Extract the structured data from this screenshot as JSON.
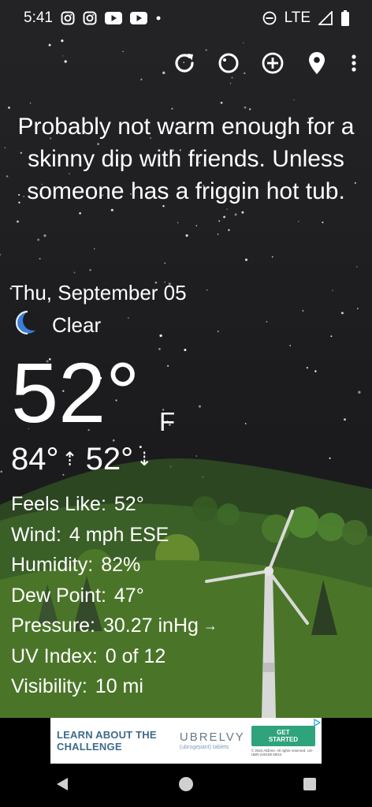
{
  "status": {
    "time": "5:41",
    "network": "LTE",
    "notification_icons": [
      "instagram-icon",
      "instagram-icon",
      "youtube-icon",
      "youtube-icon",
      "dot-icon"
    ],
    "right_icons": [
      "do-not-disturb-icon",
      "signal-icon",
      "battery-icon"
    ]
  },
  "toolbar": {
    "icons": [
      "refresh-icon",
      "theme-icon",
      "add-location-icon",
      "location-pin-icon",
      "overflow-menu-icon"
    ]
  },
  "weather": {
    "headline": "Probably not warm enough for a skinny dip with friends. Unless someone has a friggin hot tub.",
    "date": "Thu, September 05",
    "condition": "Clear",
    "condition_icon": "moon-icon",
    "temperature": "52°",
    "unit": "F",
    "high": "84°",
    "low": "52°",
    "details": [
      {
        "label": "Feels Like:",
        "value": "52°"
      },
      {
        "label": "Wind:",
        "value": "4 mph ESE"
      },
      {
        "label": "Humidity:",
        "value": "82%"
      },
      {
        "label": "Dew Point:",
        "value": "47°"
      },
      {
        "label": "Pressure:",
        "value": "30.27 inHg",
        "trend": "→"
      },
      {
        "label": "UV Index:",
        "value": "0 of 12"
      },
      {
        "label": "Visibility:",
        "value": "10 mi"
      }
    ]
  },
  "ad": {
    "text": "LEARN ABOUT THE CHALLENGE",
    "brand": "UBRELVY",
    "brand_sub": "(ubrogepant) tablets",
    "button": "GET STARTED",
    "fine_print": "© 2024 AbbVie. All rights reserved. US-UBR-240109 08/24"
  },
  "navigation": [
    "back-button",
    "home-button",
    "recents-button"
  ],
  "colors": {
    "sky": "#1d1d1f",
    "hills": "#3c6a22",
    "foreground_hill": "#4d7a2a",
    "ad_button": "#2fa37c",
    "moon": "#3b7dd8"
  }
}
